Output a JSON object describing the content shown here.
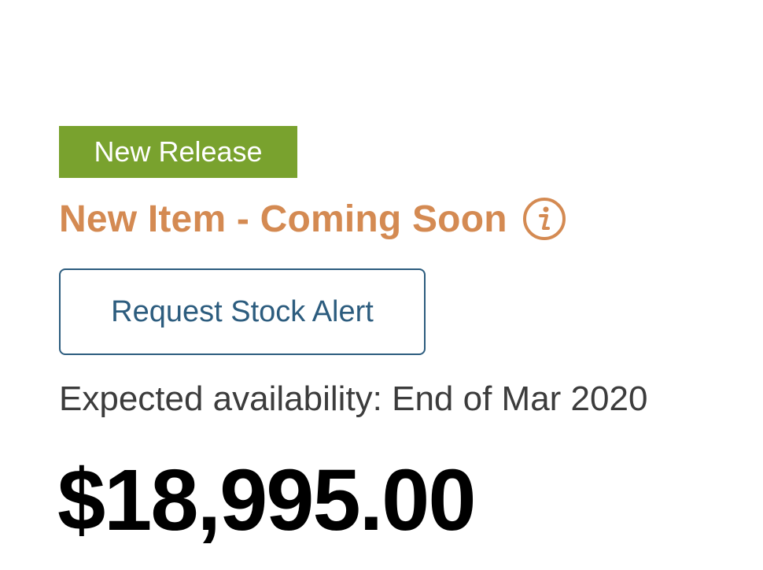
{
  "product": {
    "badge_label": "New Release",
    "status_text": "New Item - Coming Soon",
    "status_color": "#d48a52",
    "badge_color": "#79a22e",
    "info_icon": "info-icon",
    "stock_alert_label": "Request Stock Alert",
    "stock_alert_color": "#2c5c7e",
    "availability_text": "Expected availability: End of Mar 2020",
    "price": "$18,995.00"
  }
}
